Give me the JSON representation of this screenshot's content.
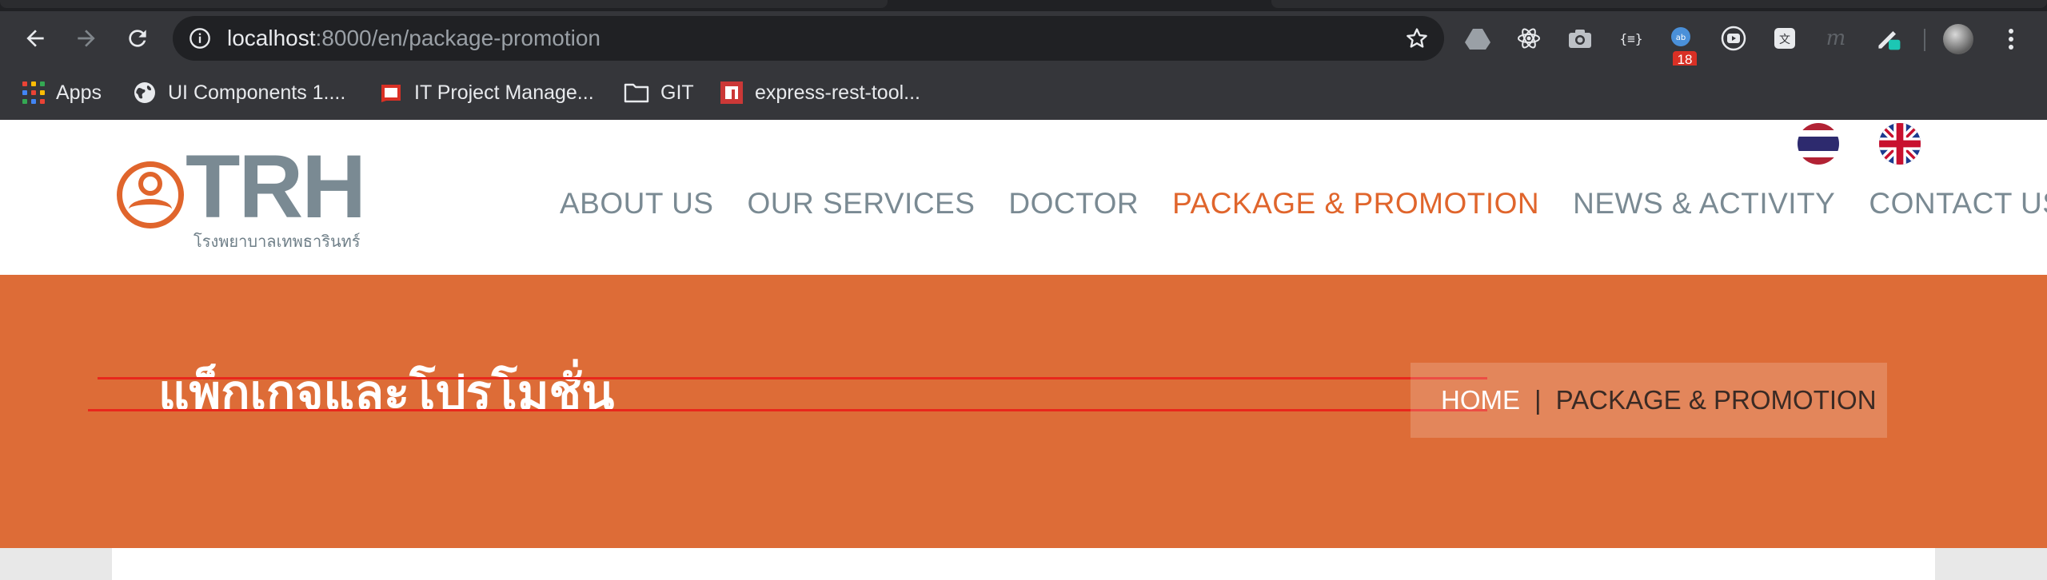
{
  "browser": {
    "url_host": "localhost",
    "url_path": ":8000/en/package-promotion",
    "extension_badge": "18",
    "bookmarks": [
      {
        "label": "Apps",
        "icon": "apps-grid-icon"
      },
      {
        "label": "UI Components 1....",
        "icon": "globe-icon"
      },
      {
        "label": "IT Project Manage...",
        "icon": "red-note-icon"
      },
      {
        "label": "GIT",
        "icon": "folder-icon"
      },
      {
        "label": "express-rest-tool...",
        "icon": "npm-icon"
      }
    ]
  },
  "site": {
    "logo_text": "TRH",
    "logo_subtitle": "โรงพยาบาลเทพธารินทร์",
    "nav": [
      {
        "label": "ABOUT US",
        "active": false
      },
      {
        "label": "OUR SERVICES",
        "active": false
      },
      {
        "label": "DOCTOR",
        "active": false
      },
      {
        "label": "PACKAGE & PROMOTION",
        "active": true
      },
      {
        "label": "NEWS & ACTIVITY",
        "active": false
      },
      {
        "label": "CONTACT US",
        "active": false
      }
    ],
    "languages": [
      "thai-flag-icon",
      "uk-flag-icon"
    ],
    "colors": {
      "accent": "#e0652c",
      "banner": "#dd6c37",
      "nav_text": "#7a8a93"
    }
  },
  "banner": {
    "title": "แพ็กเกจและโปรโมชั่น",
    "breadcrumb": {
      "home": "HOME",
      "separator": "|",
      "current": "PACKAGE & PROMOTION"
    }
  }
}
